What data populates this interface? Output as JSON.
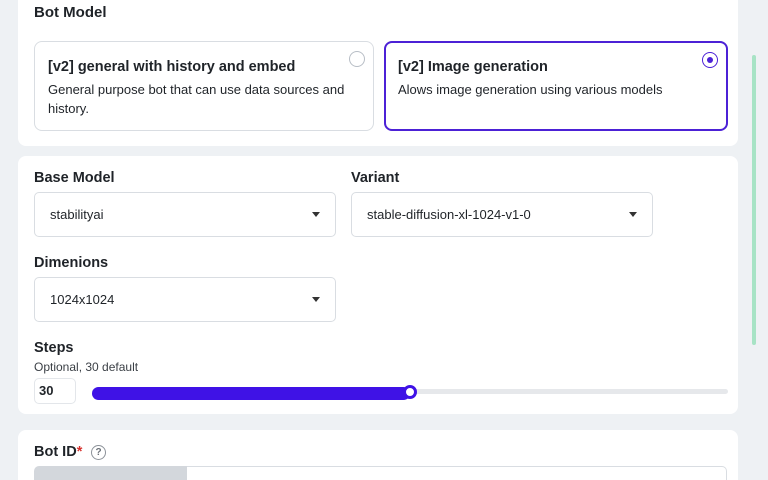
{
  "bot_model": {
    "title": "Bot Model",
    "options": [
      {
        "title": "[v2] general with history and embed",
        "description": "General purpose bot that can use data sources and history.",
        "selected": false
      },
      {
        "title": "[v2] Image generation",
        "description": "Alows image generation using various models",
        "selected": true
      }
    ]
  },
  "model_settings": {
    "base_model": {
      "label": "Base Model",
      "value": "stabilityai"
    },
    "variant": {
      "label": "Variant",
      "value": "stable-diffusion-xl-1024-v1-0"
    },
    "dimensions": {
      "label": "Dimenions",
      "value": "1024x1024"
    },
    "steps": {
      "label": "Steps",
      "hint": "Optional, 30 default",
      "value": "30",
      "slider_fraction": 0.5
    }
  },
  "bot_id": {
    "label": "Bot ID",
    "required_mark": "*",
    "help": "?"
  },
  "colors": {
    "accent": "#4c21d6",
    "slider": "#3f12e6",
    "scrollbar": "#a7e3c5"
  }
}
